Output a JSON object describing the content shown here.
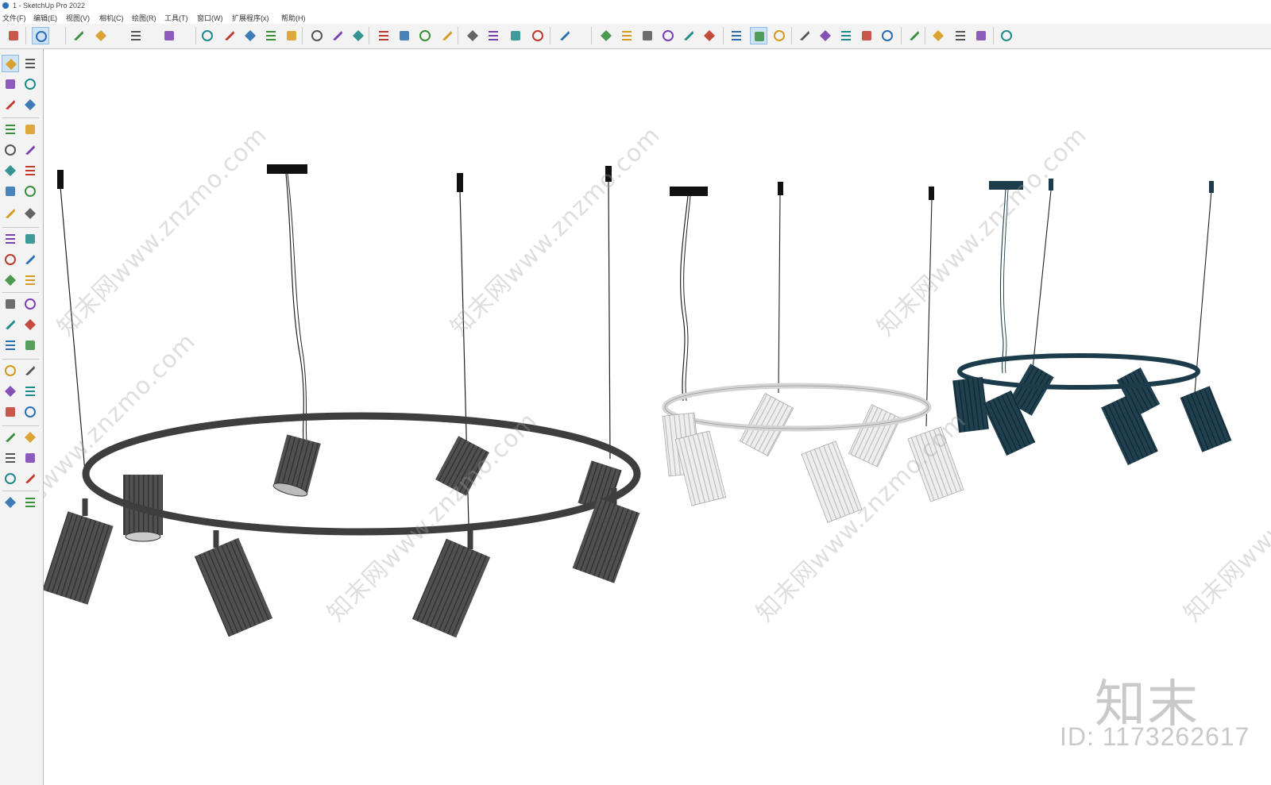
{
  "window": {
    "title": "1 - SketchUp Pro 2022"
  },
  "menu": [
    "文件(F)",
    "编辑(E)",
    "视图(V)",
    "相机(C)",
    "绘图(R)",
    "工具(T)",
    "窗口(W)",
    "扩展程序(x)",
    "帮助(H)"
  ],
  "watermark": {
    "site_text": "知末网www.znzmo.com",
    "brand": "知末",
    "id_label": "ID: 1173262617"
  },
  "colors": {
    "lamp_dark": "#4a4a4a",
    "lamp_light": "#e6e6e6",
    "lamp_teal": "#1c3c4b",
    "selection": "#cfe3f7"
  },
  "toolbar_icons": [
    "search-icon",
    "select-icon",
    "eraser-icon",
    "pencil-icon",
    "arc-icon",
    "rectangle-icon",
    "push-pull-icon",
    "follow-me-icon",
    "move-icon",
    "rotate-icon",
    "scale-icon",
    "tape-measure-icon",
    "text-icon",
    "paint-bucket-icon",
    "orbit-icon",
    "pan-icon",
    "zoom-icon",
    "zoom-extents-icon",
    "warehouse-icon",
    "sandbox-icon",
    "layers-icon",
    "sections-icon",
    "account-icon",
    "iso-view-icon",
    "top-view-icon",
    "front-view-icon",
    "right-view-icon",
    "back-view-icon",
    "left-view-icon",
    "model-info-icon",
    "components-icon",
    "styles-icon",
    "add-location-icon",
    "shadow-icon",
    "fog-icon",
    "match-photo-icon",
    "cloud-icon",
    "preferences-icon",
    "scenes-icon",
    "info-icon",
    "cart-icon",
    "user-icon"
  ],
  "side_icons": [
    "select-icon",
    "orbit-icon",
    "paint-bucket-icon",
    "eraser-icon",
    "component-icon",
    "tape-measure-icon",
    "line-icon",
    "freehand-icon",
    "rectangle-icon",
    "rotated-rectangle-icon",
    "circle-icon",
    "polygon-icon",
    "arc-icon",
    "pie-icon",
    "arc-3pt-icon",
    "2pt-arc-icon",
    "move-icon",
    "push-pull-icon",
    "rotate-icon",
    "follow-me-icon",
    "scale-icon",
    "offset-icon",
    "tape-icon",
    "dimension-icon",
    "protractor-icon",
    "text-icon",
    "axes-icon",
    "3d-text-icon",
    "orbit-icon",
    "pan-icon",
    "zoom-icon",
    "zoom-window-icon",
    "zoom-extents-icon",
    "previous-icon",
    "position-camera-icon",
    "look-around-icon",
    "walk-icon",
    "section-plane-icon",
    "sandbox-icon",
    "stamp-icon",
    "drape-icon",
    "add-detail-icon"
  ]
}
